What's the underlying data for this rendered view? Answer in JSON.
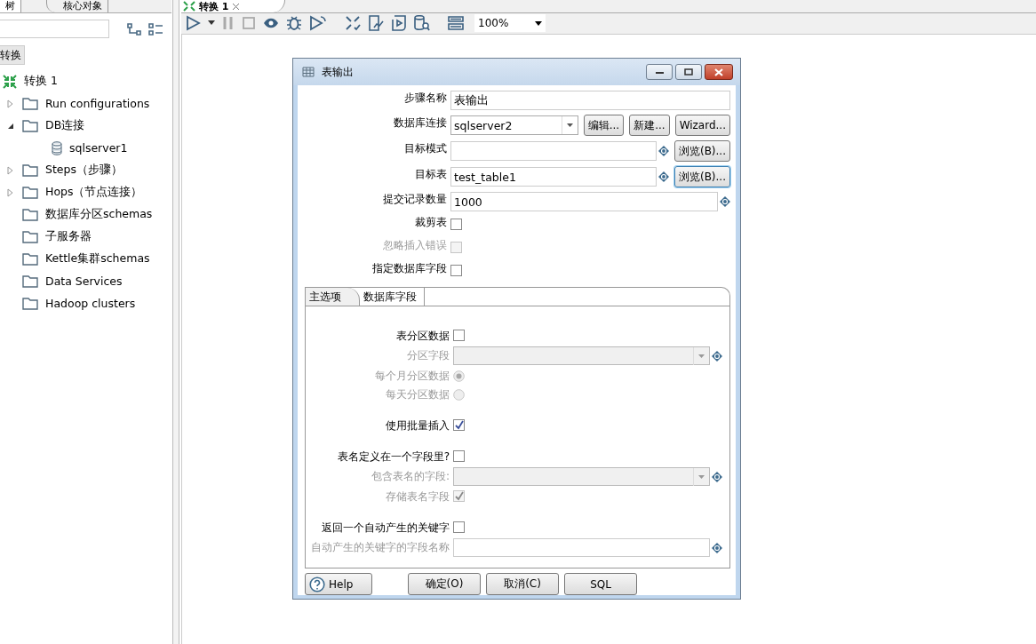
{
  "left_panel": {
    "tabs": [
      {
        "label": "树",
        "selected": true
      },
      {
        "label": "核心对象",
        "selected": false
      }
    ],
    "breadcrumb": "转换",
    "tree": [
      {
        "label": "转换 1",
        "kind": "transform",
        "children": [
          {
            "label": "Run configurations",
            "kind": "folder",
            "expanded": false
          },
          {
            "label": "DB连接",
            "kind": "folder",
            "expanded": true,
            "children": [
              {
                "label": "sqlserver1",
                "kind": "database"
              }
            ]
          },
          {
            "label": "Steps（步骤）",
            "kind": "folder",
            "expanded": false
          },
          {
            "label": "Hops（节点连接）",
            "kind": "folder",
            "expanded": false
          },
          {
            "label": "数据库分区schemas",
            "kind": "folder"
          },
          {
            "label": "子服务器",
            "kind": "folder"
          },
          {
            "label": "Kettle集群schemas",
            "kind": "folder"
          },
          {
            "label": "Data Services",
            "kind": "folder"
          },
          {
            "label": "Hadoop clusters",
            "kind": "folder"
          }
        ]
      }
    ]
  },
  "editor_tabs": [
    {
      "label": "转换 1",
      "selected": true
    }
  ],
  "toolbar": {
    "zoom": "100%"
  },
  "dialog": {
    "title": "表输出",
    "rows": [
      {
        "kind": "text",
        "label": "步骤名称",
        "value": "表输出"
      },
      {
        "kind": "combo",
        "label": "数据库连接",
        "value": "sqlserver2",
        "buttons": [
          "编辑...",
          "新建...",
          "Wizard..."
        ]
      },
      {
        "kind": "text",
        "label": "目标模式",
        "variable": true,
        "buttons": [
          "浏览(B)..."
        ]
      },
      {
        "kind": "text",
        "label": "目标表",
        "value": "test_table1",
        "variable": true,
        "buttons": [
          "浏览(B)..."
        ],
        "focused": true
      },
      {
        "kind": "text",
        "label": "提交记录数量",
        "value": "1000",
        "variable": true
      },
      {
        "kind": "checkbox",
        "label": "裁剪表",
        "checked": false,
        "disabled": false
      },
      {
        "kind": "checkbox",
        "label": "忽略插入错误",
        "checked": false,
        "disabled": true
      },
      {
        "kind": "checkbox",
        "label": "指定数据库字段",
        "checked": false,
        "disabled": false
      }
    ],
    "tabs": [
      {
        "label": "主选项",
        "selected": true
      },
      {
        "label": "数据库字段",
        "selected": false
      }
    ],
    "tab_sections": [
      {
        "rows": [
          {
            "kind": "checkbox",
            "label": "表分区数据",
            "checked": false,
            "disabled": false
          },
          {
            "kind": "combo",
            "label": "分区字段",
            "disabled": true,
            "variable": true
          },
          {
            "kind": "radio",
            "label": "每个月分区数据",
            "selected": true,
            "disabled": true
          },
          {
            "kind": "radio",
            "label": "每天分区数据",
            "selected": false,
            "disabled": true
          }
        ]
      },
      {
        "rows": [
          {
            "kind": "checkbox",
            "label": "使用批量插入",
            "checked": true,
            "disabled": false
          }
        ]
      },
      {
        "rows": [
          {
            "kind": "checkbox",
            "label": "表名定义在一个字段里?",
            "checked": false,
            "disabled": false
          },
          {
            "kind": "combo",
            "label": "包含表名的字段:",
            "disabled": true,
            "variable": true
          },
          {
            "kind": "checkbox",
            "label": "存储表名字段",
            "checked": true,
            "disabled": true
          }
        ]
      },
      {
        "rows": [
          {
            "kind": "checkbox",
            "label": "返回一个自动产生的关键字",
            "checked": false,
            "disabled": false
          },
          {
            "kind": "text",
            "label": "自动产生的关键字的字段名称",
            "disabled": true,
            "variable": true
          }
        ]
      }
    ],
    "help_button": "Help",
    "buttons": [
      "确定(O)",
      "取消(C)",
      "SQL"
    ]
  }
}
